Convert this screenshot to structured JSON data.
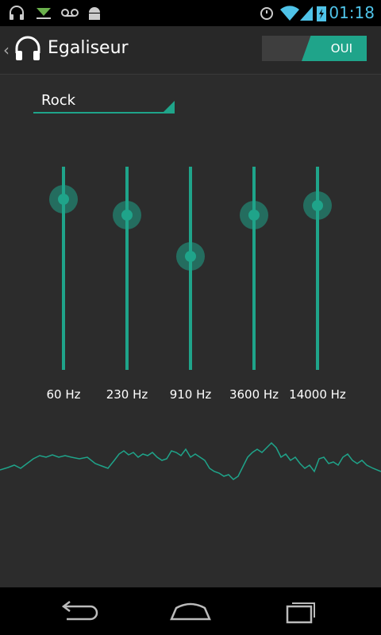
{
  "statusbar": {
    "time": "01:18",
    "icons": [
      "headphones-icon",
      "download-icon",
      "voicemail-icon",
      "android-icon",
      "alarm-icon",
      "wifi-icon",
      "signal-icon",
      "battery-icon"
    ]
  },
  "actionbar": {
    "title": "Egaliseur",
    "toggle_label": "OUI"
  },
  "preset": {
    "label": "Rock"
  },
  "bands": [
    {
      "label": "60 Hz",
      "level": 0.84
    },
    {
      "label": "230 Hz",
      "level": 0.76
    },
    {
      "label": "910 Hz",
      "level": 0.56
    },
    {
      "label": "3600 Hz",
      "level": 0.76
    },
    {
      "label": "14000 Hz",
      "level": 0.81
    }
  ],
  "colors": {
    "accent": "#1fa48a",
    "background": "#2c2c2c"
  },
  "nav": [
    "back-icon",
    "home-icon",
    "recent-apps-icon"
  ]
}
